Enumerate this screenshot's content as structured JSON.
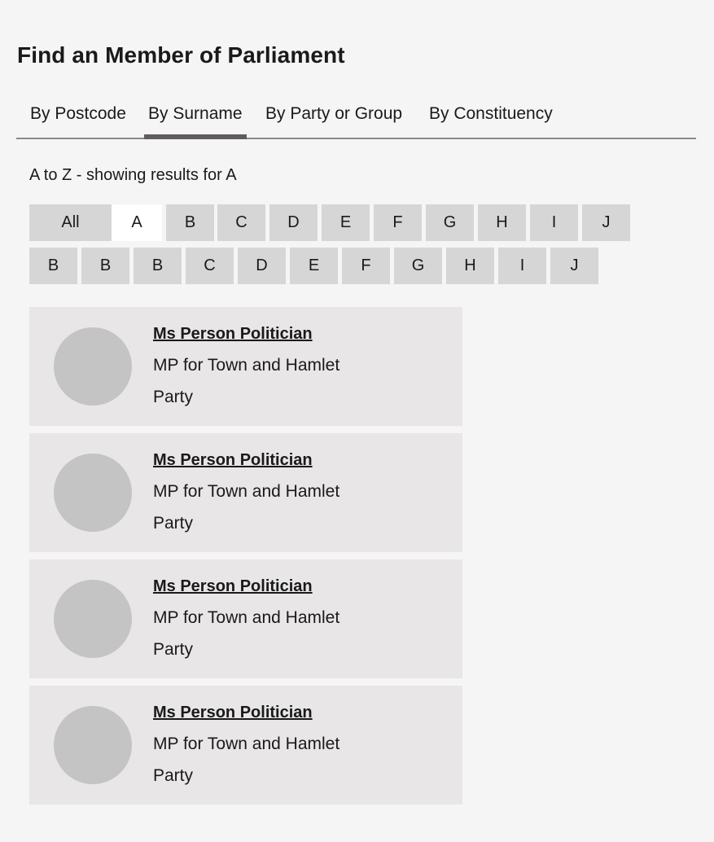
{
  "page": {
    "title": "Find an Member of Parliament"
  },
  "tabs": [
    {
      "label": "By Postcode"
    },
    {
      "label": "By Surname"
    },
    {
      "label": "By Party or Group"
    },
    {
      "label": "By Constituency"
    }
  ],
  "active_tab": "By Surname",
  "results": {
    "caption": "A to Z - showing results for A",
    "selected_letter": "A"
  },
  "letters_row1": [
    "All",
    "A",
    "B",
    "C",
    "D",
    "E",
    "F",
    "G",
    "H",
    "I",
    "J"
  ],
  "letters_row2": [
    "B",
    "B",
    "B",
    "C",
    "D",
    "E",
    "F",
    "G",
    "H",
    "I",
    "J"
  ],
  "members": [
    {
      "name": "Ms Person Politician",
      "constituency": "MP for Town and Hamlet",
      "party": "Party"
    },
    {
      "name": "Ms Person Politician",
      "constituency": "MP for Town and Hamlet",
      "party": "Party"
    },
    {
      "name": "Ms Person Politician",
      "constituency": "MP for Town and Hamlet",
      "party": "Party"
    },
    {
      "name": "Ms Person Politician",
      "constituency": "MP for Town and Hamlet",
      "party": "Party"
    }
  ],
  "colors": {
    "background": "#f5f5f5",
    "tab_indicator": "#615d5e",
    "letter_button": "#d6d6d6",
    "letter_selected": "#ffffff",
    "card": "#e8e6e7",
    "avatar_placeholder": "#c4c4c4"
  }
}
